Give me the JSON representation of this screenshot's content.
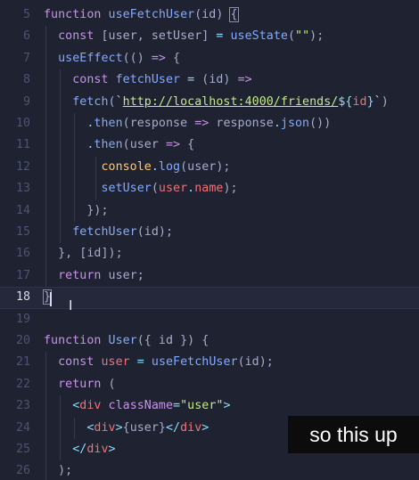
{
  "editor": {
    "lines": [
      {
        "num": "5",
        "text": "function useFetchUser(id) {"
      },
      {
        "num": "6",
        "text": "const [user, setUser] = useState(\"\");"
      },
      {
        "num": "7",
        "text": "useEffect(() => {"
      },
      {
        "num": "8",
        "text": "const fetchUser = (id) =>"
      },
      {
        "num": "9",
        "text": "fetch(`http://localhost:4000/friends/${id}`)"
      },
      {
        "num": "10",
        "text": ".then(response => response.json())"
      },
      {
        "num": "11",
        "text": ".then(user => {"
      },
      {
        "num": "12",
        "text": "console.log(user);"
      },
      {
        "num": "13",
        "text": "setUser(user.name);"
      },
      {
        "num": "14",
        "text": "});"
      },
      {
        "num": "15",
        "text": "fetchUser(id);"
      },
      {
        "num": "16",
        "text": "}, [id]);"
      },
      {
        "num": "17",
        "text": "return user;"
      },
      {
        "num": "18",
        "text": "}"
      },
      {
        "num": "19",
        "text": ""
      },
      {
        "num": "20",
        "text": "function User({ id }) {"
      },
      {
        "num": "21",
        "text": "const user = useFetchUser(id);"
      },
      {
        "num": "22",
        "text": "return ("
      },
      {
        "num": "23",
        "text": "<div className=\"user\">"
      },
      {
        "num": "24",
        "text": "<div>{user}</div>"
      },
      {
        "num": "25",
        "text": "</div>"
      },
      {
        "num": "26",
        "text": ");"
      }
    ],
    "current_line": "18"
  },
  "caption": {
    "text": "so this up"
  },
  "colors": {
    "background": "#1f2230",
    "keyword": "#c792ea",
    "function": "#82aaff",
    "variable": "#f07178",
    "string": "#c3e88d",
    "punctuation": "#89ddff"
  }
}
